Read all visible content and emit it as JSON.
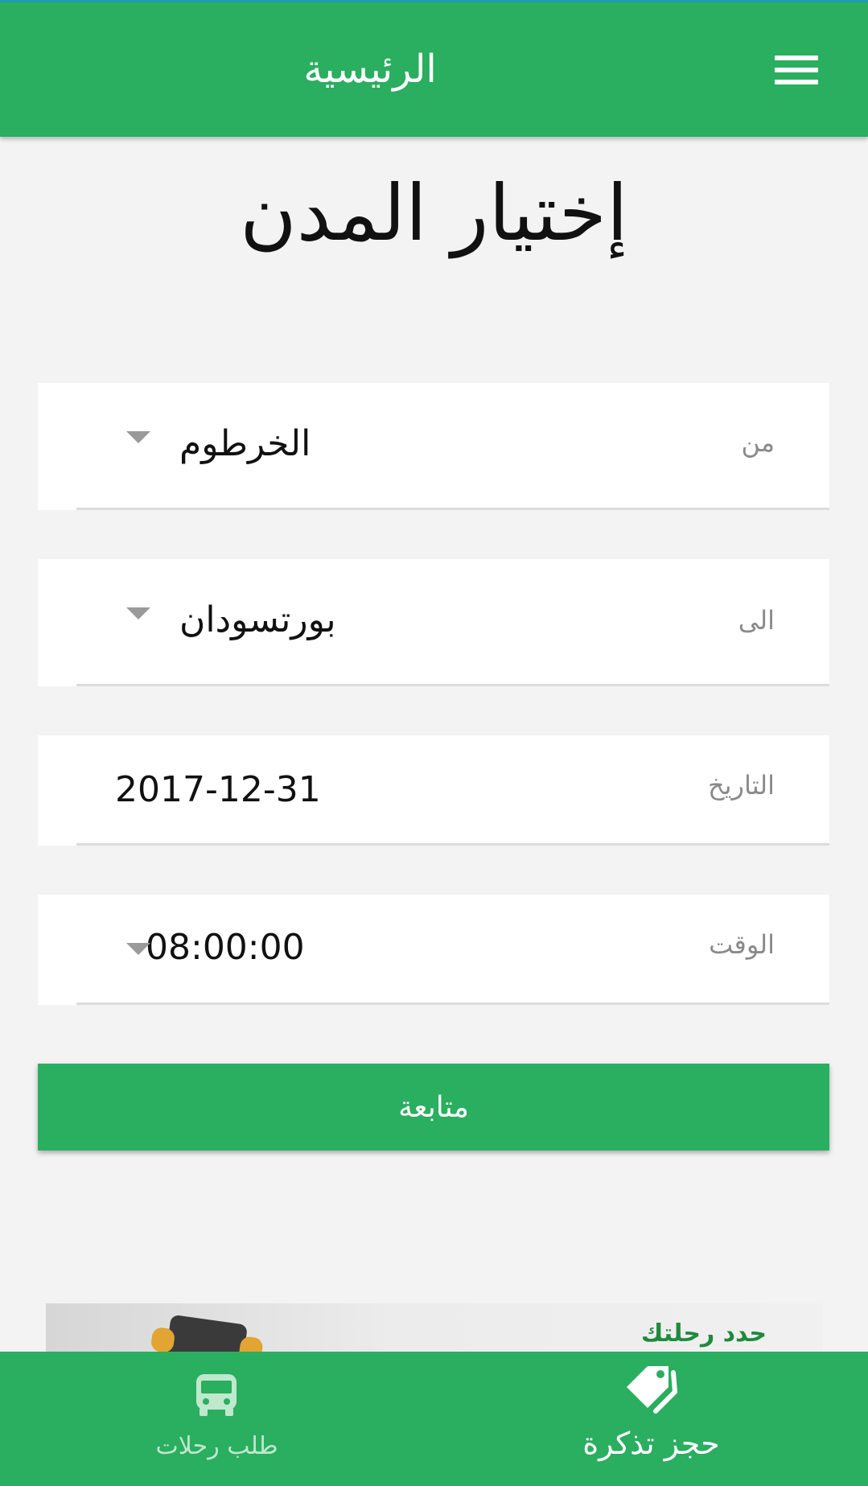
{
  "appbar": {
    "title": "الرئيسية",
    "menu_icon": "hamburger-menu-icon"
  },
  "heading": "إختيار المدن",
  "form": {
    "from": {
      "label": "من",
      "value": "الخرطوم"
    },
    "to": {
      "label": "الى",
      "value": "بورتسودان"
    },
    "date": {
      "label": "التاريخ",
      "value": "2017-12-31"
    },
    "time": {
      "label": "الوقت",
      "value": "08:00:00"
    }
  },
  "continue_label": "متابعة",
  "banner": {
    "text": "حدد رحلتك"
  },
  "bottom_nav": {
    "trips": {
      "label": "طلب رحلات",
      "icon": "bus-icon"
    },
    "book": {
      "label": "حجز تذكرة",
      "icon": "ticket-tag-icon"
    }
  },
  "colors": {
    "primary": "#2aae5f",
    "background": "#f3f3f3",
    "label": "#8a8a8a"
  }
}
